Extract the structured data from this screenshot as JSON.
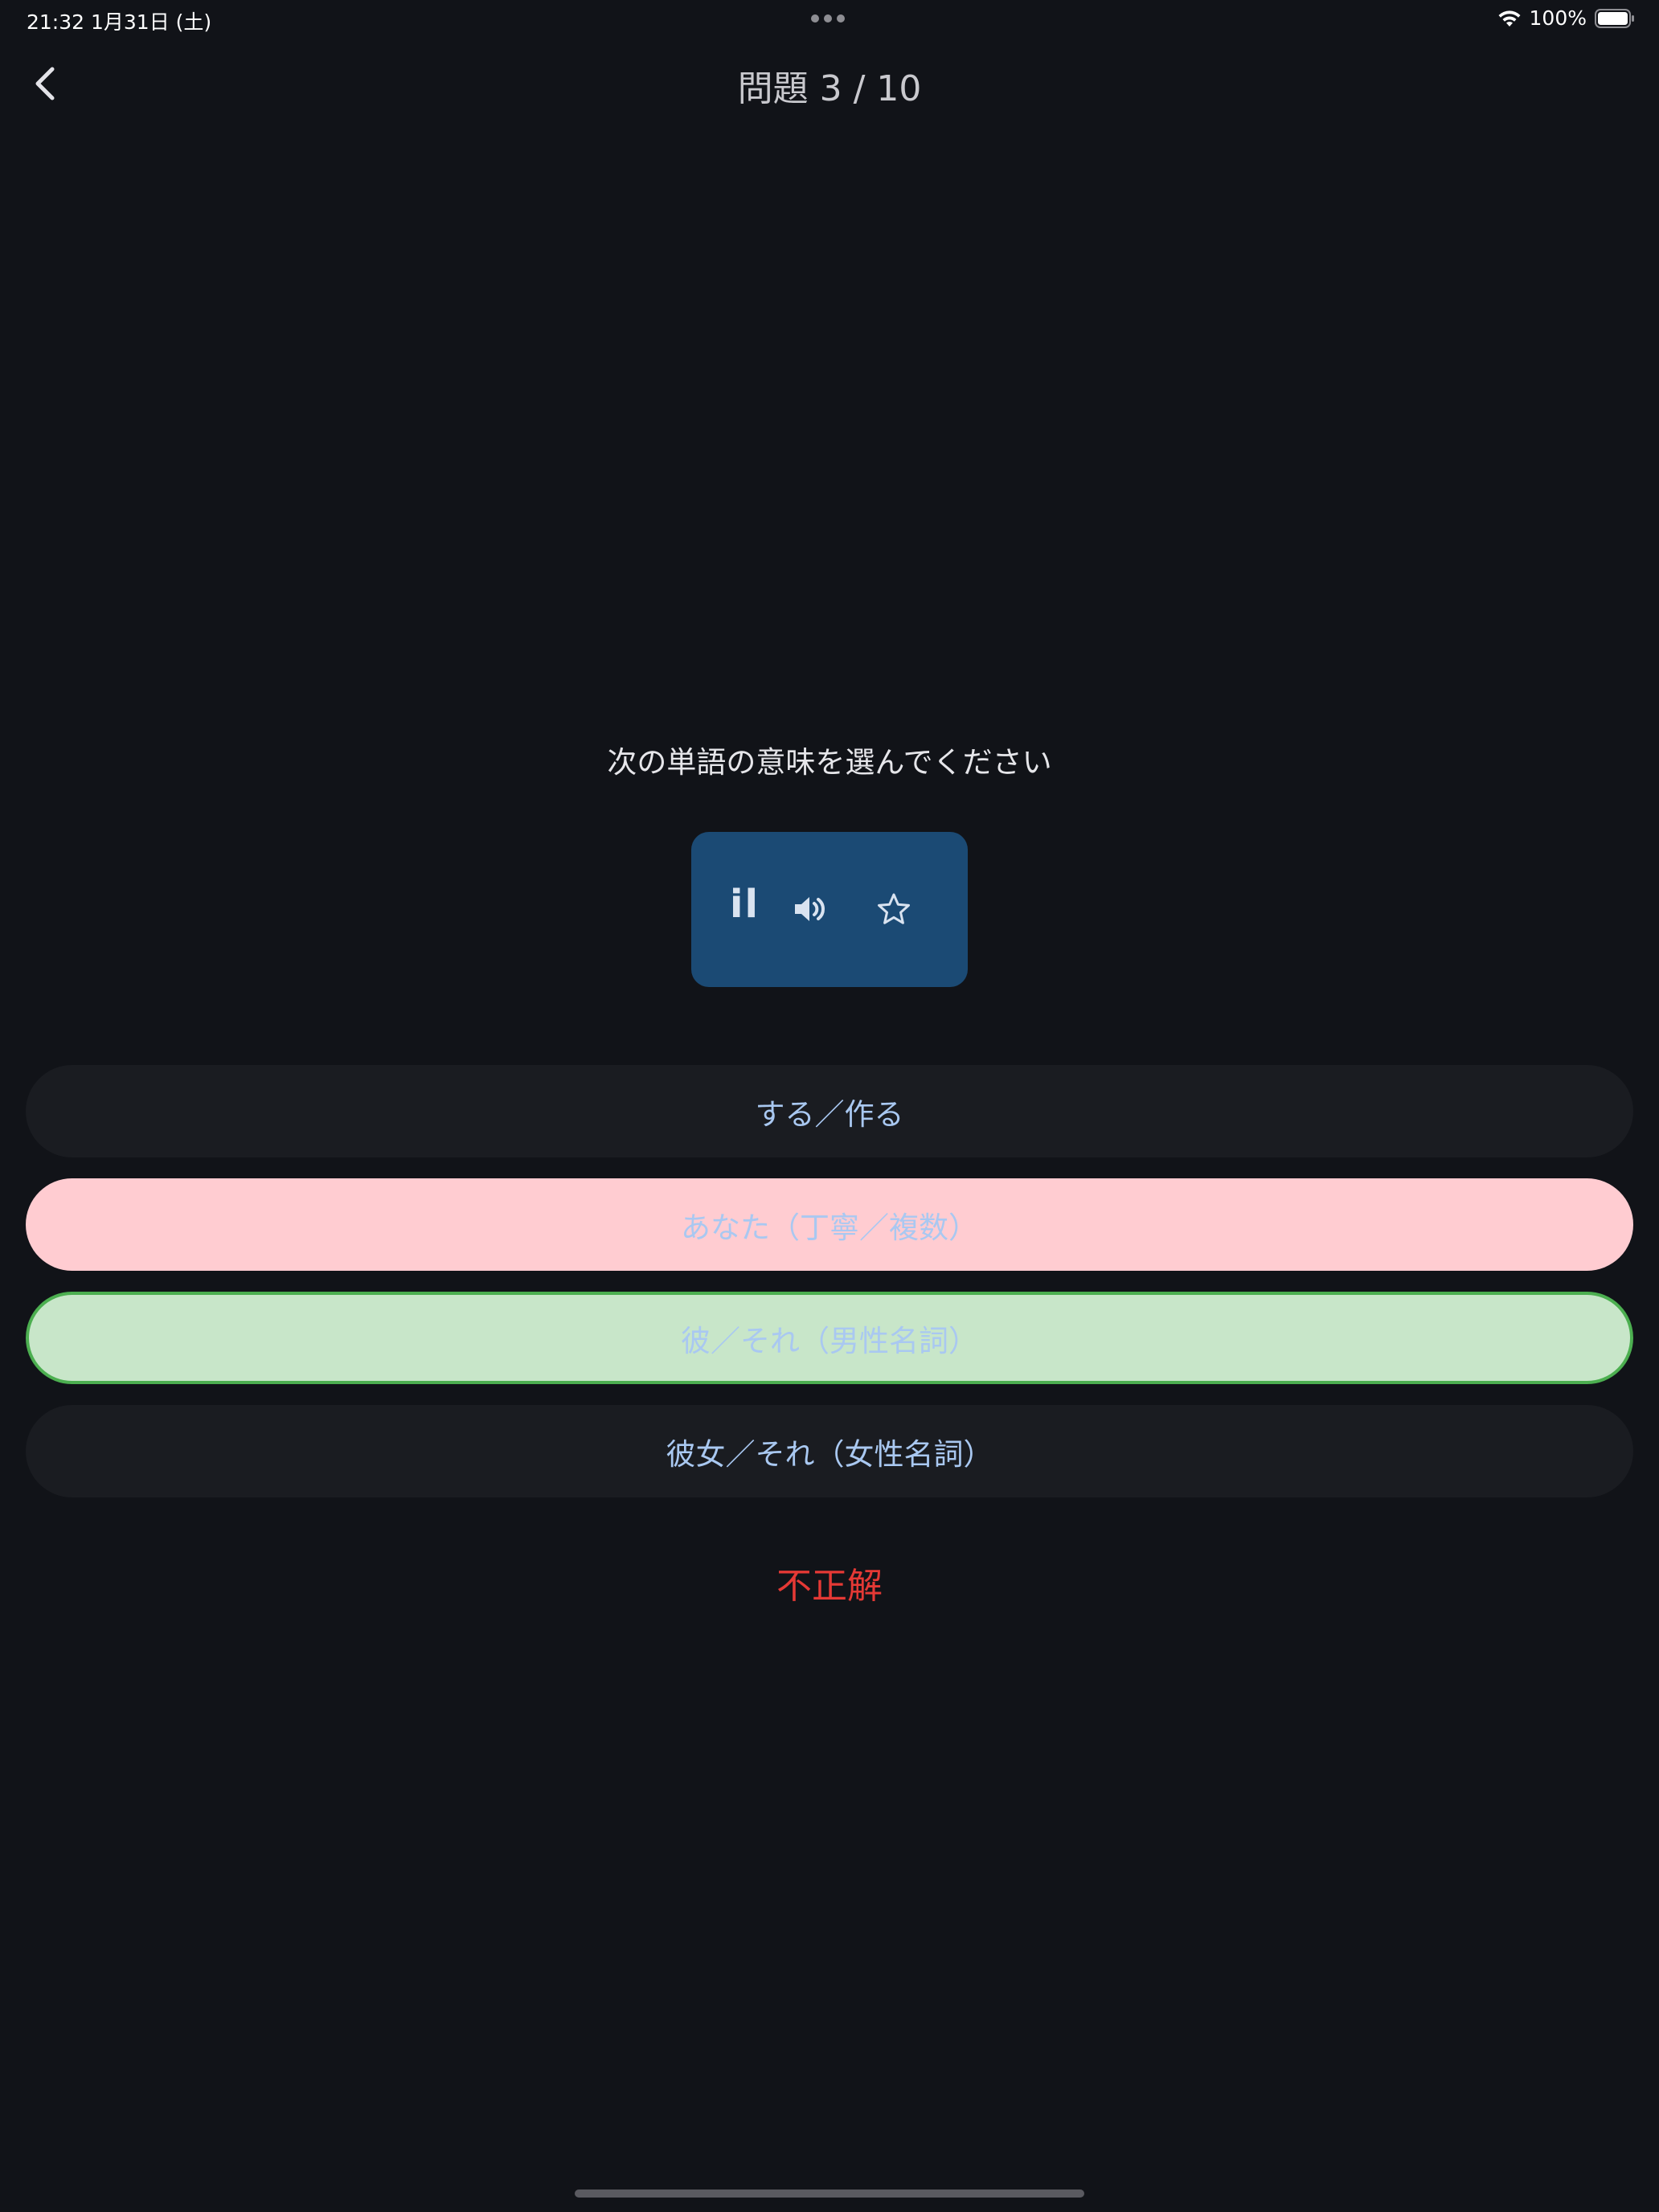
{
  "status_bar": {
    "time_date": "21:32   1月31日 (土)",
    "battery_percent": "100%",
    "battery_level": 1.0
  },
  "header": {
    "title": "問題 3 / 10",
    "back_icon": "chevron-left-icon"
  },
  "quiz": {
    "prompt": "次の単語の意味を選んでください",
    "word": "il",
    "speaker_icon": "speaker-icon",
    "favorite_icon": "star-outline-icon",
    "options": [
      {
        "label": "する／作る",
        "state": "neutral"
      },
      {
        "label": "あなた（丁寧／複数）",
        "state": "wrong"
      },
      {
        "label": "彼／それ（男性名詞）",
        "state": "correct"
      },
      {
        "label": "彼女／それ（女性名詞）",
        "state": "neutral"
      }
    ],
    "result": "不正解"
  },
  "colors": {
    "background": "#111318",
    "card": "#1b4a74",
    "option_text": "#a9c8f1",
    "wrong_bg": "#ffccd1",
    "correct_bg": "#c8e6c9",
    "correct_border": "#4caf50",
    "result_text": "#e53935"
  }
}
